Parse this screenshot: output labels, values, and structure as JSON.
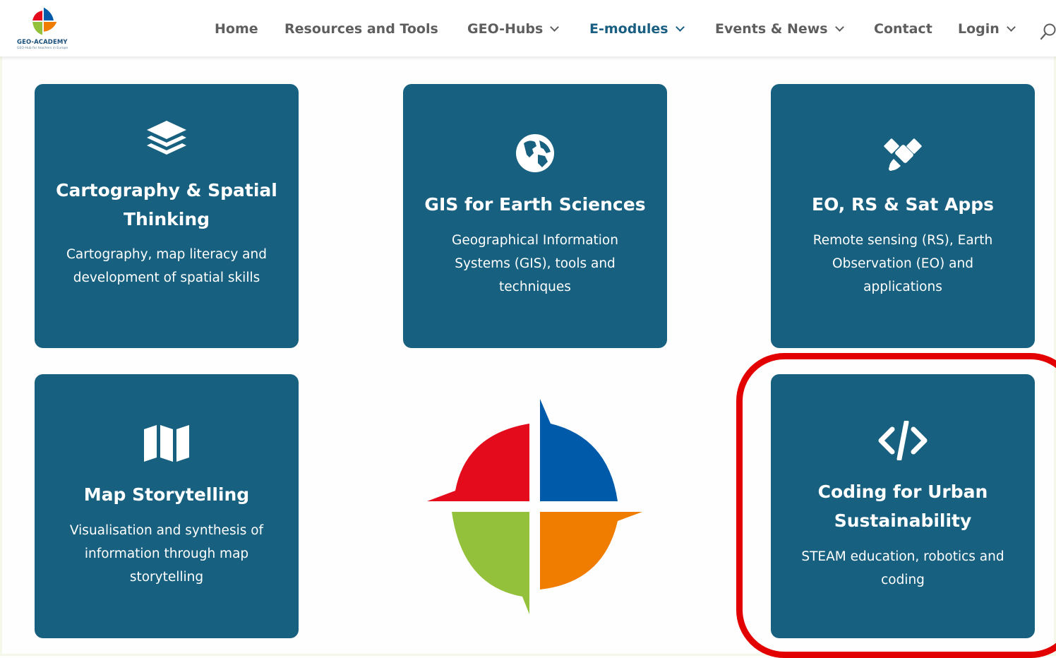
{
  "site": {
    "logo_name": "GEO-ACADEMY",
    "logo_tagline": "GEO-Hub for teachers in Europe"
  },
  "nav": [
    {
      "label": "Home",
      "dropdown": false,
      "active": false
    },
    {
      "label": "Resources and Tools",
      "dropdown": false,
      "active": false
    },
    {
      "label": "GEO-Hubs",
      "dropdown": true,
      "active": false
    },
    {
      "label": "E-modules",
      "dropdown": true,
      "active": true
    },
    {
      "label": "Events & News",
      "dropdown": true,
      "active": false
    },
    {
      "label": "Contact",
      "dropdown": false,
      "active": false
    },
    {
      "label": "Login",
      "dropdown": true,
      "active": false
    }
  ],
  "modules": [
    {
      "icon": "layers-icon",
      "title": "Cartography & Spatial Thinking",
      "description": "Cartography, map literacy and development of spatial skills"
    },
    {
      "icon": "globe-icon",
      "title": "GIS for Earth Sciences",
      "description": "Geographical Information Systems (GIS), tools and techniques"
    },
    {
      "icon": "satellite-icon",
      "title": "EO, RS & Sat Apps",
      "description": "Remote sensing (RS), Earth Observation (EO) and applications"
    },
    {
      "icon": "map-icon",
      "title": "Map Storytelling",
      "description": "Visualisation and synthesis of information through map storytelling"
    },
    {
      "icon": "code-icon",
      "title": "Coding for Urban Sustainability",
      "description": "STEAM education, robotics and coding"
    }
  ],
  "colors": {
    "card_bg": "#17607f",
    "nav_text": "#5e5e5e",
    "nav_active": "#1a5f82",
    "highlight": "#e30000",
    "logo_red": "#e30b1c",
    "logo_blue": "#005aaa",
    "logo_green": "#94c13b",
    "logo_orange": "#f07d00"
  }
}
